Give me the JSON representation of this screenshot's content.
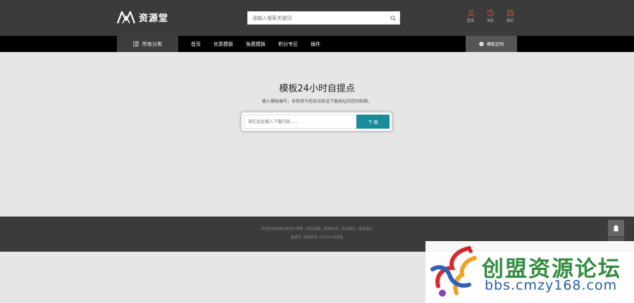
{
  "header": {
    "logo_text": "资源堂",
    "search_placeholder": "请输入搜索关键词",
    "actions": [
      {
        "icon": "user-icon",
        "label": "登录"
      },
      {
        "icon": "clock-icon",
        "label": "浏览"
      },
      {
        "icon": "list-icon",
        "label": "帮助"
      }
    ]
  },
  "nav": {
    "category_label": "所有分类",
    "items": [
      "首页",
      "优质模板",
      "免费模板",
      "积分专区",
      "插件"
    ],
    "right_label": "模板定制"
  },
  "main": {
    "title": "模板24小时自提点",
    "subtitle": "输入模板编号，系统将为您自动发送下载地址到您的邮箱。",
    "input_placeholder": "请在此处输入下载内容……",
    "button_label": "下 载"
  },
  "footer": {
    "line1": "本站所有资源均来源于网络 | 网站地图 | 模板申请 | 投诉建议 | 联系我们",
    "line2": "备案号: 版权所有 ©2024 资源堂"
  },
  "watermark": {
    "title": "创盟资源论坛",
    "url": "bbs.cmzy168.com"
  },
  "colors": {
    "header_bg": "#3b3b3b",
    "nav_bg": "#000000",
    "accent_button": "#1a8b9a",
    "action_icon": "#d9534f"
  }
}
